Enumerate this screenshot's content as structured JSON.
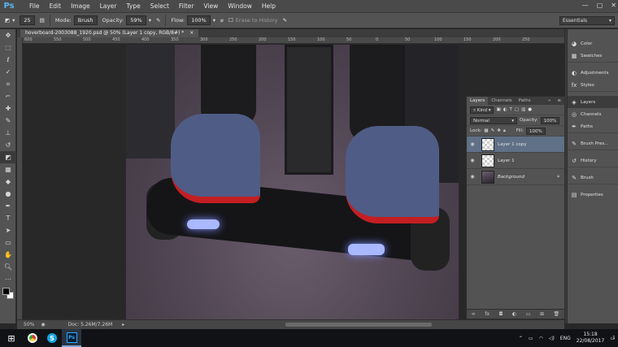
{
  "app": {
    "logo": "Ps",
    "menus": [
      "File",
      "Edit",
      "Image",
      "Layer",
      "Type",
      "Select",
      "Filter",
      "View",
      "Window",
      "Help"
    ],
    "window_controls": [
      "—",
      "▢",
      "✕"
    ]
  },
  "options": {
    "brush_size": "25",
    "mode_label": "Mode:",
    "mode_value": "Brush",
    "opacity_label": "Opacity:",
    "opacity_value": "59%",
    "flow_label": "Flow:",
    "flow_value": "100%",
    "erase_history": "Erase to History",
    "workspace": "Essentials"
  },
  "document": {
    "tab_title": "hoverboard-2003088_1920.psd @ 50% (Layer 1 copy, RGB/8#) *",
    "ruler_marks": [
      "600",
      "550",
      "500",
      "450",
      "400",
      "350",
      "300",
      "250",
      "200",
      "150",
      "100",
      "50",
      "0",
      "50",
      "100",
      "150",
      "200",
      "250"
    ]
  },
  "status": {
    "zoom": "50%",
    "doc_size": "Doc: 5.26M/7.26M"
  },
  "layers_panel": {
    "tabs": [
      "Layers",
      "Channels",
      "Paths"
    ],
    "kind_label": "Kind",
    "blend_mode": "Normal",
    "opacity_label": "Opacity:",
    "opacity_value": "100%",
    "lock_label": "Lock:",
    "fill_label": "Fill:",
    "fill_value": "100%",
    "layers": [
      {
        "name": "Layer 1 copy",
        "selected": true
      },
      {
        "name": "Layer 1",
        "selected": false
      },
      {
        "name": "Background",
        "selected": false
      }
    ]
  },
  "dock": {
    "items": [
      "Color",
      "Swatches",
      "Adjustments",
      "Styles",
      "Layers",
      "Channels",
      "Paths",
      "Brush Pres...",
      "History",
      "Brush",
      "Properties"
    ]
  },
  "taskbar": {
    "lang": "ENG",
    "time": "15:18",
    "date": "22/08/2017",
    "notification_count": "1"
  }
}
